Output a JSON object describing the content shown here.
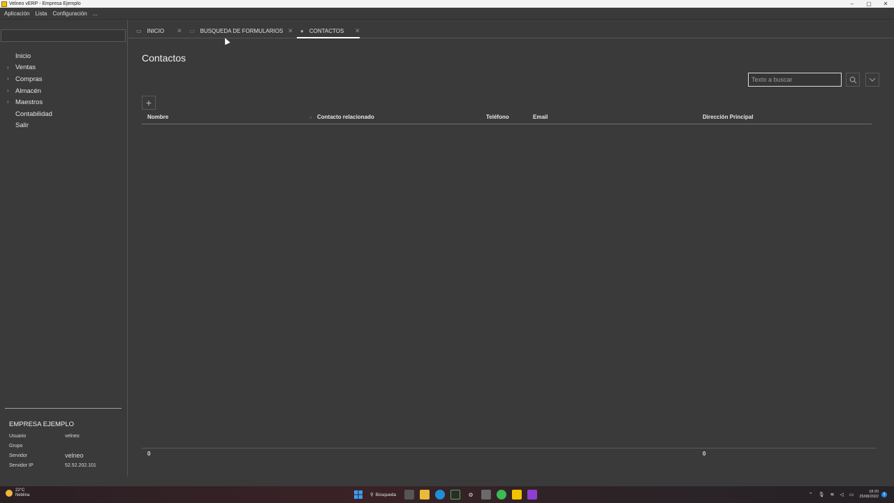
{
  "window": {
    "title": "Velneo vERP - Empresa Ejemplo"
  },
  "menubar": {
    "items": [
      "Aplicación",
      "Lista",
      "Configuración",
      "..."
    ]
  },
  "sidebar": {
    "search_value": "",
    "items": [
      {
        "label": "Inicio",
        "expandable": false
      },
      {
        "label": "Ventas",
        "expandable": true
      },
      {
        "label": "Compras",
        "expandable": true
      },
      {
        "label": "Almacén",
        "expandable": true
      },
      {
        "label": "Maestros",
        "expandable": true
      },
      {
        "label": "Contabilidad",
        "expandable": false
      },
      {
        "label": "Salir",
        "expandable": false
      }
    ],
    "company": "EMPRESA EJEMPLO",
    "info": [
      {
        "key": "Usuario",
        "value": "velneo"
      },
      {
        "key": "Grupo",
        "value": ""
      },
      {
        "key": "Servidor",
        "value": "velneo"
      },
      {
        "key": "Servidor IP",
        "value": "52.52.202.101"
      }
    ]
  },
  "tabs": [
    {
      "label": "INICIO",
      "icon": "folder-icon",
      "active": false
    },
    {
      "label": "BUSQUEDA DE FORMULARIOS",
      "icon": "form-icon",
      "active": false
    },
    {
      "label": "CONTACTOS",
      "icon": "person-icon",
      "active": true
    }
  ],
  "main": {
    "title": "Contactos",
    "search_placeholder": "Texto a buscar",
    "columns": [
      "Nombre",
      "Contacto relacionado",
      "Teléfono",
      "Email",
      "Dirección Principal"
    ],
    "rows": [],
    "footer_totals": [
      "0",
      "0"
    ]
  },
  "taskbar": {
    "weather_temp": "22°C",
    "weather_desc": "Neblina",
    "search_label": "Búsqueda",
    "time": "18:20",
    "date": "25/08/2022",
    "notifications": "3"
  },
  "colors": {
    "background": "#3a3a3a",
    "text": "#e6e6e6",
    "accent_active_tab": "#ffffff"
  }
}
